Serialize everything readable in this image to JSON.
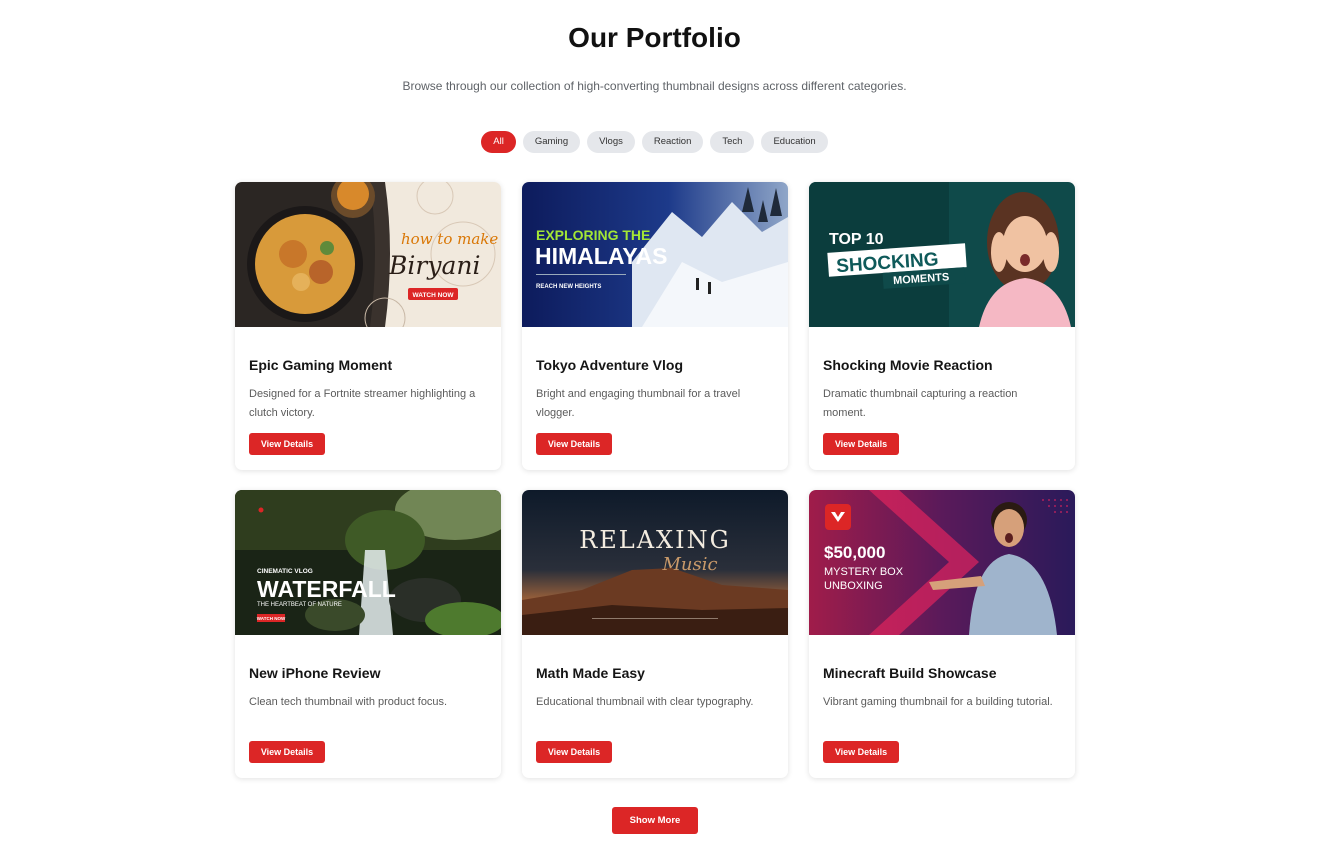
{
  "header": {
    "title": "Our Portfolio",
    "subtitle": "Browse through our collection of high-converting thumbnail designs across different categories."
  },
  "filters": [
    {
      "label": "All",
      "active": true
    },
    {
      "label": "Gaming",
      "active": false
    },
    {
      "label": "Vlogs",
      "active": false
    },
    {
      "label": "Reaction",
      "active": false
    },
    {
      "label": "Tech",
      "active": false
    },
    {
      "label": "Education",
      "active": false
    }
  ],
  "cards": [
    {
      "title": "Epic Gaming Moment",
      "description": "Designed for a Fortnite streamer highlighting a clutch victory.",
      "button": "View Details",
      "thumb": {
        "line1": "how to make",
        "line2": "Biryani",
        "badge": "WATCH NOW"
      }
    },
    {
      "title": "Tokyo Adventure Vlog",
      "description": "Bright and engaging thumbnail for a travel vlogger.",
      "button": "View Details",
      "thumb": {
        "line1": "EXPLORING THE",
        "line2": "HIMALAYAS",
        "tagline": "REACH NEW HEIGHTS"
      }
    },
    {
      "title": "Shocking Movie Reaction",
      "description": "Dramatic thumbnail capturing a reaction moment.",
      "button": "View Details",
      "thumb": {
        "line1": "TOP 10",
        "line2": "SHOCKING",
        "line3": "MOMENTS"
      }
    },
    {
      "title": "New iPhone Review",
      "description": "Clean tech thumbnail with product focus.",
      "button": "View Details",
      "thumb": {
        "line1": "CINEMATIC VLOG",
        "line2": "WATERFALL",
        "line3": "THE HEARTBEAT OF NATURE",
        "badge": "WATCH NOW"
      }
    },
    {
      "title": "Math Made Easy",
      "description": "Educational thumbnail with clear typography.",
      "button": "View Details",
      "thumb": {
        "line1": "RELAXING",
        "line2": "Music"
      }
    },
    {
      "title": "Minecraft Build Showcase",
      "description": "Vibrant gaming thumbnail for a building tutorial.",
      "button": "View Details",
      "thumb": {
        "line1": "$50,000",
        "line2": "MYSTERY BOX",
        "line3": "UNBOXING"
      }
    }
  ],
  "show_more": "Show More",
  "colors": {
    "accent": "#dc2626",
    "chip": "#e5e7eb"
  }
}
